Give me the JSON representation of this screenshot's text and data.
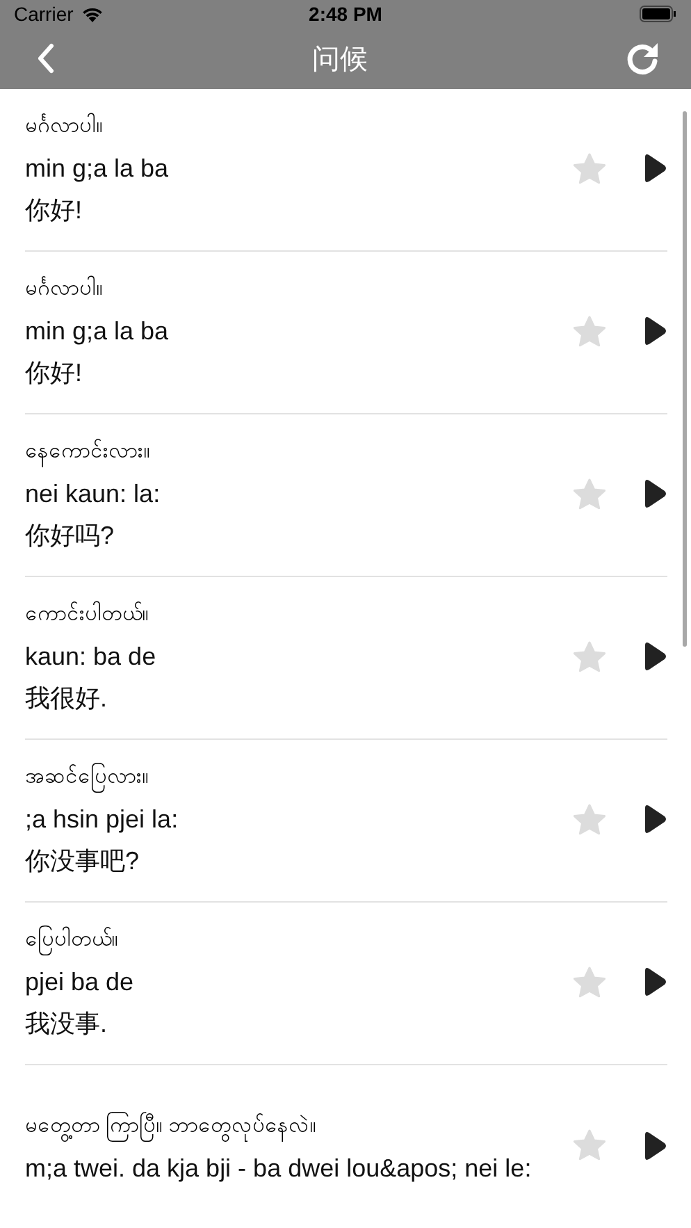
{
  "status_bar": {
    "carrier": "Carrier",
    "time": "2:48 PM"
  },
  "nav_bar": {
    "title": "问候"
  },
  "phrases": [
    {
      "burmese": "မင်္ဂလာပါ။",
      "romanization": "min g;a la ba",
      "chinese": "你好!",
      "starred": false
    },
    {
      "burmese": "မင်္ဂလာပါ။",
      "romanization": "min g;a la ba",
      "chinese": "你好!",
      "starred": false
    },
    {
      "burmese": "နေကောင်းလား။",
      "romanization": "nei kaun: la:",
      "chinese": "你好吗?",
      "starred": false
    },
    {
      "burmese": "ကောင်းပါတယ်။",
      "romanization": "kaun: ba de",
      "chinese": "我很好.",
      "starred": false
    },
    {
      "burmese": "အဆင်ပြေလား။",
      "romanization": ";a hsin pjei la:",
      "chinese": "你没事吧?",
      "starred": false
    },
    {
      "burmese": "ပြေပါတယ်။",
      "romanization": "pjei ba de",
      "chinese": "我没事.",
      "starred": false
    },
    {
      "burmese": "မတွေ့တာ ကြာပြီ။ ဘာတွေလုပ်နေလဲ။",
      "romanization": "m;a twei. da kja bji - ba dwei lou&apos; nei le:",
      "starred": false
    }
  ]
}
